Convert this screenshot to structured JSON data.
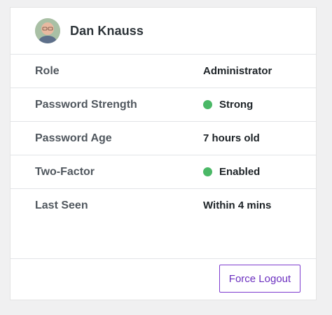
{
  "user": {
    "name": "Dan Knauss"
  },
  "details": [
    {
      "label": "Role",
      "value": "Administrator",
      "status_dot": false
    },
    {
      "label": "Password Strength",
      "value": "Strong",
      "status_dot": true
    },
    {
      "label": "Password Age",
      "value": "7 hours old",
      "status_dot": false
    },
    {
      "label": "Two-Factor",
      "value": "Enabled",
      "status_dot": true
    },
    {
      "label": "Last Seen",
      "value": "Within 4 mins",
      "status_dot": false
    }
  ],
  "actions": {
    "force_logout_label": "Force Logout"
  },
  "colors": {
    "status_ok": "#4ab866",
    "accent": "#7e3bcf"
  }
}
